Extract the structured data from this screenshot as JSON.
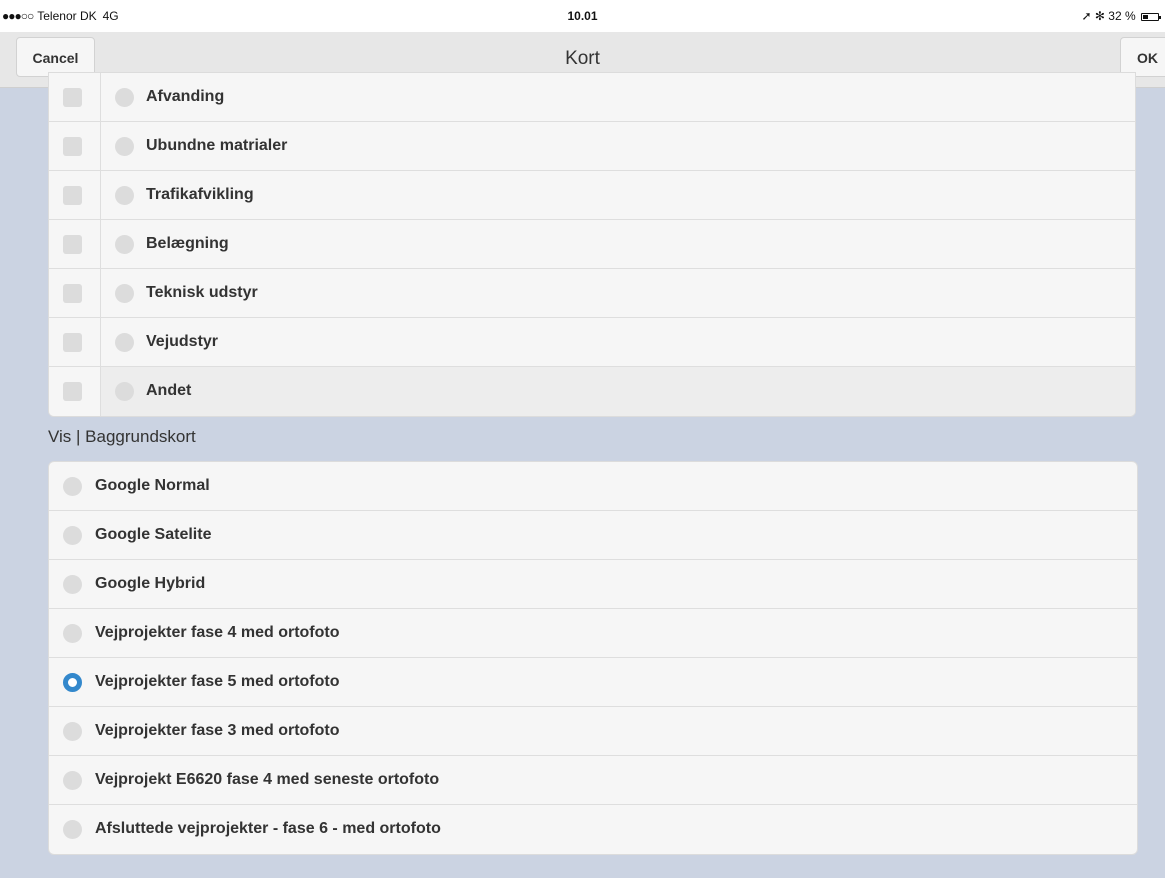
{
  "status_bar": {
    "signal": "●●●○○",
    "carrier": "Telenor DK",
    "network": "4G",
    "time": "10.01",
    "location_icon": "location-arrow-icon",
    "bluetooth_icon": "bluetooth-icon",
    "battery": "32 %",
    "battery_level": 0.32
  },
  "nav": {
    "cancel_label": "Cancel",
    "title": "Kort",
    "ok_label": "OK"
  },
  "layers": {
    "items": [
      {
        "label": "Afvanding",
        "checked": false,
        "selected": false
      },
      {
        "label": "Ubundne matrialer",
        "checked": false,
        "selected": false
      },
      {
        "label": "Trafikafvikling",
        "checked": false,
        "selected": false
      },
      {
        "label": "Belægning",
        "checked": false,
        "selected": false
      },
      {
        "label": "Teknisk udstyr",
        "checked": false,
        "selected": false
      },
      {
        "label": "Vejudstyr",
        "checked": false,
        "selected": false
      },
      {
        "label": "Andet",
        "checked": false,
        "selected": false
      }
    ]
  },
  "background_maps": {
    "header": "Vis | Baggrundskort",
    "selected_index": 4,
    "options": [
      {
        "label": "Google Normal"
      },
      {
        "label": "Google Satelite"
      },
      {
        "label": "Google Hybrid"
      },
      {
        "label": "Vejprojekter fase 4 med ortofoto"
      },
      {
        "label": "Vejprojekter fase 5 med ortofoto"
      },
      {
        "label": "Vejprojekter fase 3 med ortofoto"
      },
      {
        "label": "Vejprojekt E6620 fase 4 med seneste ortofoto"
      },
      {
        "label": "Afsluttede vejprojekter - fase 6 - med ortofoto"
      }
    ]
  },
  "colors": {
    "accent": "#3388cc",
    "background": "#cbd3e2"
  }
}
